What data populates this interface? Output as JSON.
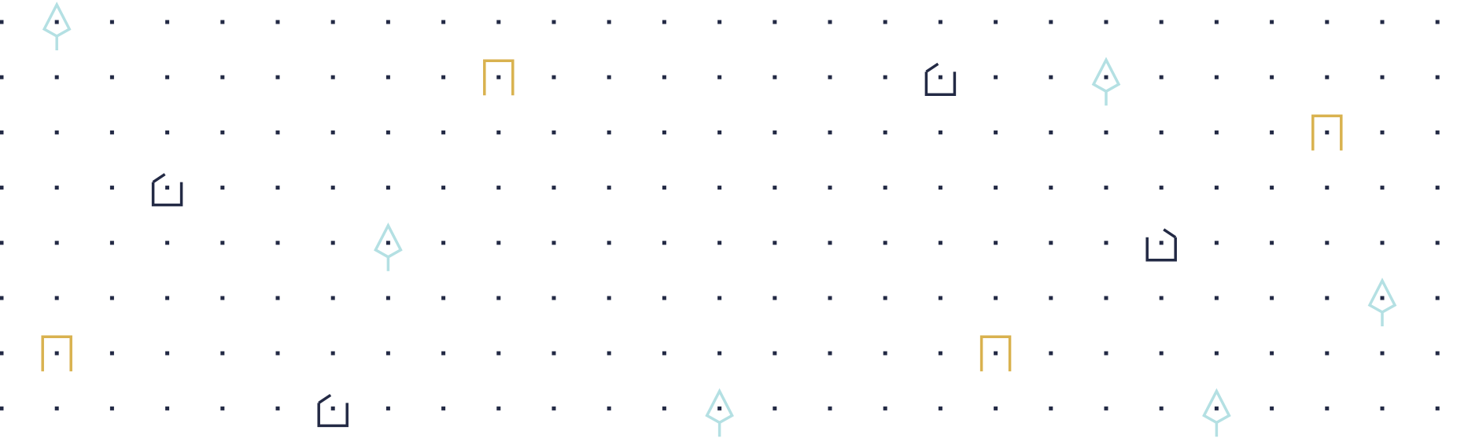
{
  "pattern": {
    "colors": {
      "background": "#ffffff",
      "dot": "#232a45",
      "arrow_icon": "#b4e0e3",
      "gate_icon": "#d9b24f",
      "house_icon": "#232a45"
    },
    "icons": [
      {
        "icon": "arrow-up-icon",
        "col": 1,
        "row": 0
      },
      {
        "icon": "gate-icon",
        "col": 9,
        "row": 1
      },
      {
        "icon": "house-icon",
        "col": 17,
        "row": 1
      },
      {
        "icon": "arrow-up-icon",
        "col": 20,
        "row": 1
      },
      {
        "icon": "gate-icon",
        "col": 24,
        "row": 2
      },
      {
        "icon": "house-icon",
        "col": 3,
        "row": 3
      },
      {
        "icon": "arrow-up-icon",
        "col": 7,
        "row": 4
      },
      {
        "icon": "house-mirrored-icon",
        "col": 21,
        "row": 4
      },
      {
        "icon": "arrow-up-icon",
        "col": 25,
        "row": 5
      },
      {
        "icon": "gate-icon",
        "col": 1,
        "row": 6
      },
      {
        "icon": "gate-icon",
        "col": 18,
        "row": 6
      },
      {
        "icon": "house-icon",
        "col": 6,
        "row": 7
      },
      {
        "icon": "arrow-up-icon",
        "col": 13,
        "row": 7
      },
      {
        "icon": "arrow-up-icon",
        "col": 22,
        "row": 7
      }
    ]
  }
}
